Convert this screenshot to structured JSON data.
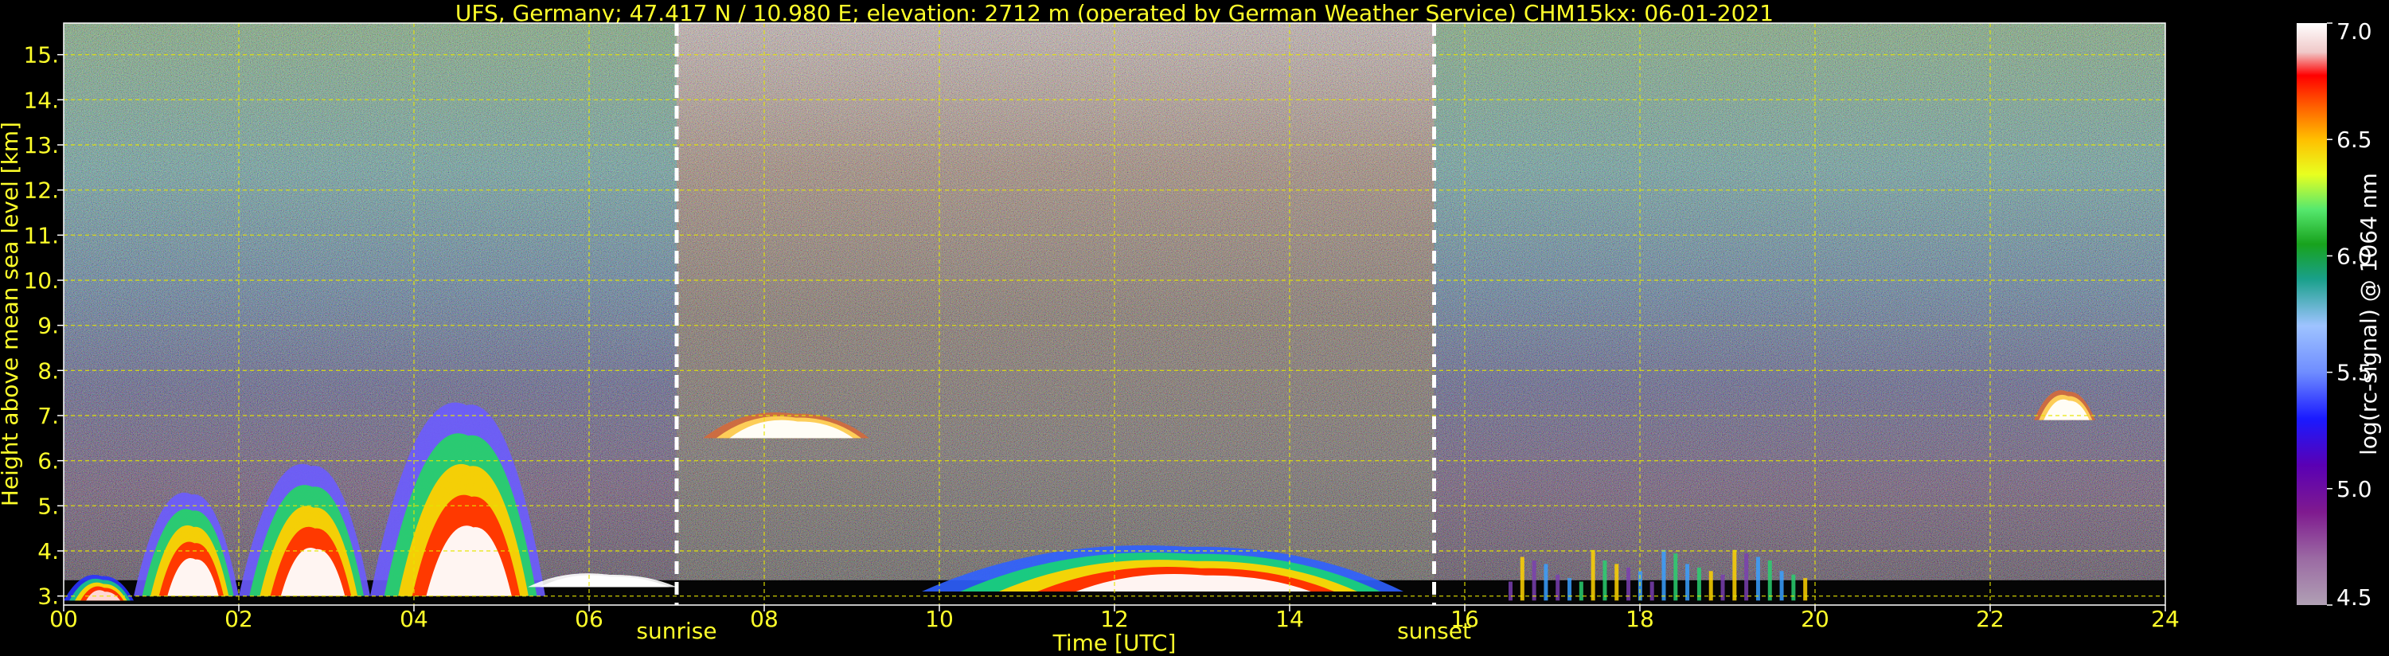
{
  "chart_data": {
    "type": "heatmap",
    "title": "UFS, Germany; 47.417 N / 10.980 E; elevation: 2712 m  (operated by German Weather Service)    CHM15kx: 06-01-2021",
    "xlabel": "Time [UTC]",
    "ylabel": "Height above mean sea level [km]",
    "xlim": [
      0,
      24
    ],
    "ylim": [
      2.8,
      15.7
    ],
    "x_ticks": [
      0,
      2,
      4,
      6,
      8,
      10,
      12,
      14,
      16,
      18,
      20,
      22,
      24
    ],
    "x_tick_labels": [
      "00",
      "02",
      "04",
      "06",
      "08",
      "10",
      "12",
      "14",
      "16",
      "18",
      "20",
      "22",
      "24"
    ],
    "y_ticks": [
      3,
      4,
      5,
      6,
      7,
      8,
      9,
      10,
      11,
      12,
      13,
      14,
      15
    ],
    "y_tick_labels": [
      "3.",
      "4.",
      "5.",
      "6.",
      "7.",
      "8.",
      "9.",
      "10.",
      "11.",
      "12.",
      "13.",
      "14.",
      "15."
    ],
    "grid": true,
    "events": [
      {
        "label": "sunrise",
        "time": 7.0
      },
      {
        "label": "sunset",
        "time": 15.65
      }
    ],
    "colorbar": {
      "label": "log(rc-signal) @ 1064 nm",
      "range": [
        4.5,
        7.0
      ],
      "ticks": [
        4.5,
        5.0,
        5.5,
        6.0,
        6.5,
        7.0
      ],
      "tick_labels": [
        "4.5",
        "5.0",
        "5.5",
        "6.0",
        "6.5",
        "7.0"
      ]
    },
    "features": [
      {
        "kind": "boundary_layer",
        "t0": 0.0,
        "t1": 0.8,
        "bottom": 2.9,
        "top": 3.5
      },
      {
        "kind": "aerosol_plume",
        "t0": 0.8,
        "t1": 2.0,
        "bottom": 3.0,
        "top": 5.5
      },
      {
        "kind": "aerosol_plume",
        "t0": 2.0,
        "t1": 3.5,
        "bottom": 3.0,
        "top": 6.2
      },
      {
        "kind": "aerosol_plume",
        "t0": 3.5,
        "t1": 5.5,
        "bottom": 3.0,
        "top": 7.7
      },
      {
        "kind": "thin_layer",
        "t0": 5.3,
        "t1": 7.0,
        "bottom": 3.2,
        "top": 3.5
      },
      {
        "kind": "elevated_layer",
        "t0": 7.3,
        "t1": 9.2,
        "bottom": 6.5,
        "top": 7.1
      },
      {
        "kind": "cloud_layer",
        "t0": 9.8,
        "t1": 15.3,
        "bottom": 3.1,
        "top": 4.2
      },
      {
        "kind": "scattered_columns",
        "t0": 16.5,
        "t1": 20.0,
        "bottom": 2.9,
        "top": 4.1
      },
      {
        "kind": "elevated_layer",
        "t0": 22.5,
        "t1": 23.2,
        "bottom": 6.9,
        "top": 7.6
      }
    ]
  }
}
